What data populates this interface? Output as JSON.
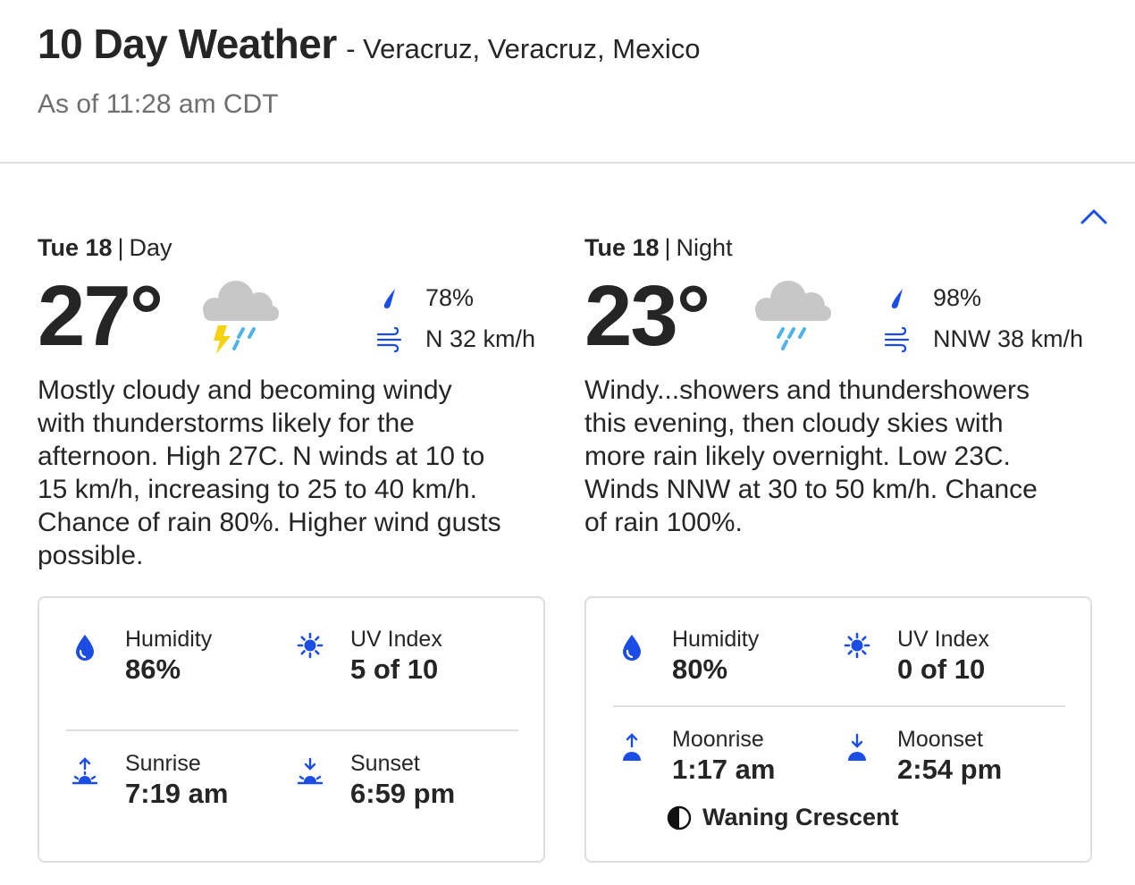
{
  "header": {
    "title": "10 Day Weather",
    "location": "- Veracruz, Veracruz, Mexico",
    "as_of": "As of 11:28 am CDT"
  },
  "day": {
    "date": "Tue 18",
    "separator": "|",
    "period": "Day",
    "temperature": "27°",
    "icon": "thunderstorm-icon",
    "precip": "78%",
    "wind": "N 32 km/h",
    "narrative": "Mostly cloudy and becoming windy with thunderstorms likely for the afternoon. High 27C. N winds at 10 to 15 km/h, increasing to 25 to 40 km/h. Chance of rain 80%. Higher wind gusts possible.",
    "details": {
      "humidity_label": "Humidity",
      "humidity": "86%",
      "uv_label": "UV Index",
      "uv": "5 of 10",
      "sunrise_label": "Sunrise",
      "sunrise": "7:19 am",
      "sunset_label": "Sunset",
      "sunset": "6:59 pm"
    }
  },
  "night": {
    "date": "Tue 18",
    "separator": "|",
    "period": "Night",
    "temperature": "23°",
    "icon": "rain-icon",
    "precip": "98%",
    "wind": "NNW 38 km/h",
    "narrative": "Windy...showers and thundershowers this evening, then cloudy skies with more rain likely overnight. Low 23C. Winds NNW at 30 to 50 km/h. Chance of rain 100%.",
    "details": {
      "humidity_label": "Humidity",
      "humidity": "80%",
      "uv_label": "UV Index",
      "uv": "0 of 10",
      "moonrise_label": "Moonrise",
      "moonrise": "1:17 am",
      "moonset_label": "Moonset",
      "moonset": "2:54 pm",
      "moon_phase": "Waning Crescent"
    }
  },
  "colors": {
    "accent": "#1b4de4",
    "cloud": "#c7c7c7",
    "rain": "#4fb3e8",
    "bolt": "#f5d311",
    "text": "#252525",
    "muted": "#6f6f6f",
    "border": "#dedede"
  }
}
